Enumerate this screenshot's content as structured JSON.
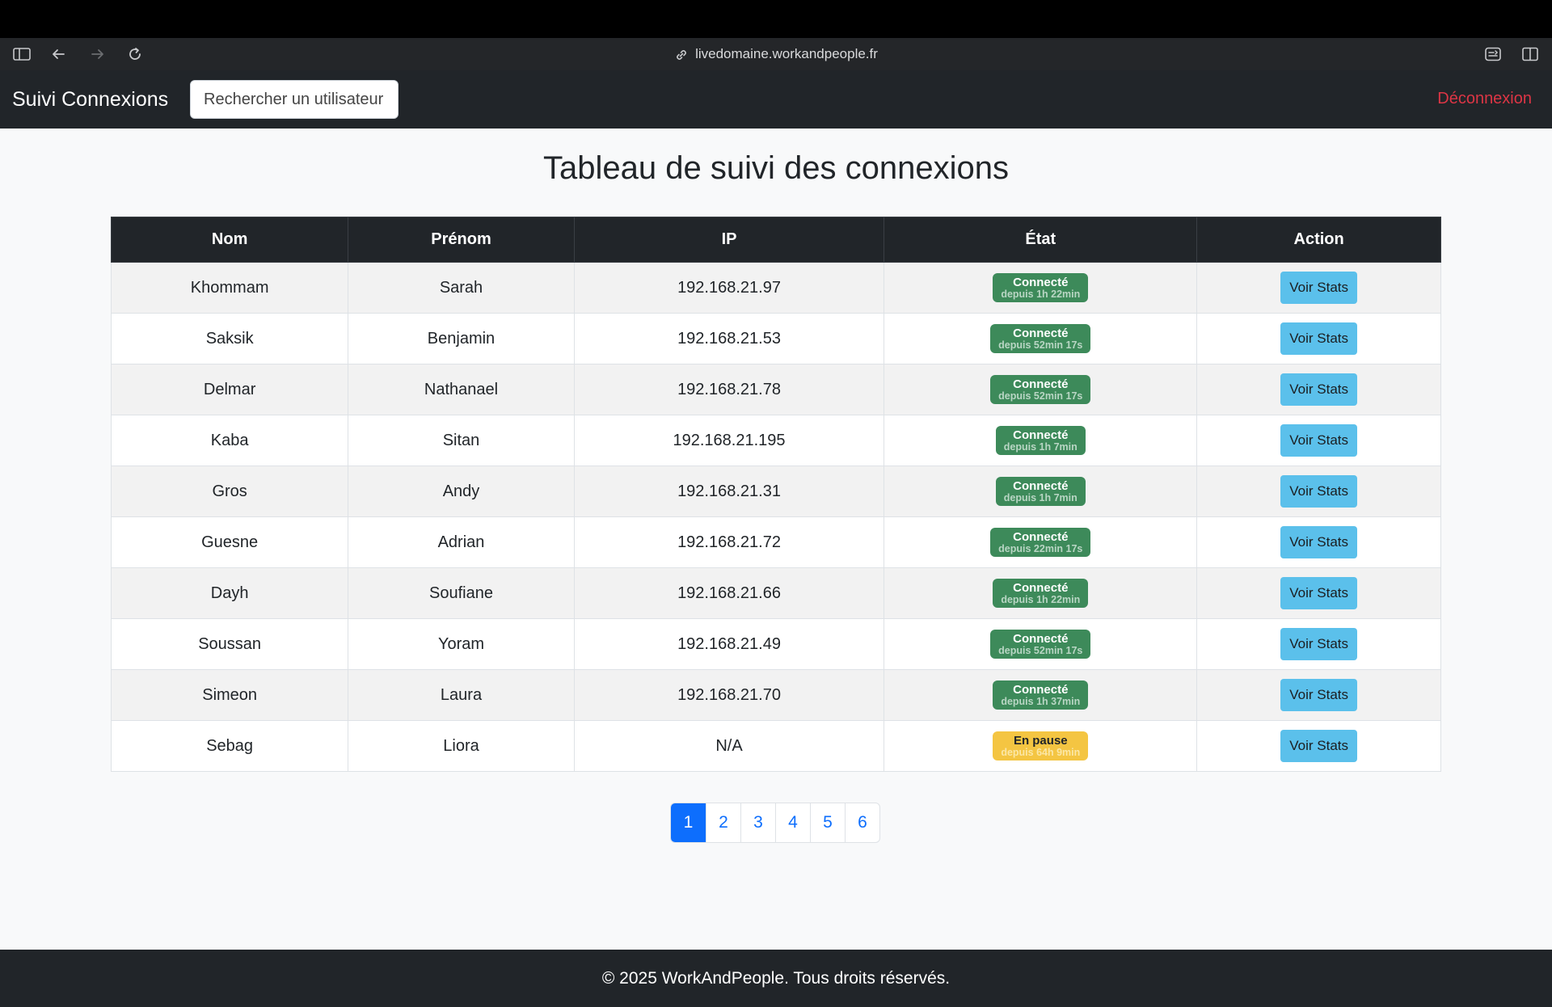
{
  "browser": {
    "url": "livedomaine.workandpeople.fr"
  },
  "navbar": {
    "brand": "Suivi Connexions",
    "search_placeholder": "Rechercher un utilisateur",
    "logout_label": "Déconnexion"
  },
  "page_title": "Tableau de suivi des connexions",
  "table": {
    "headers": [
      "Nom",
      "Prénom",
      "IP",
      "État",
      "Action"
    ],
    "rows": [
      {
        "nom": "Khommam",
        "prenom": "Sarah",
        "ip": "192.168.21.97",
        "etat": "Connecté",
        "depuis": "depuis 1h 22min",
        "status": "ok",
        "action": "Voir Stats"
      },
      {
        "nom": "Saksik",
        "prenom": "Benjamin",
        "ip": "192.168.21.53",
        "etat": "Connecté",
        "depuis": "depuis 52min 17s",
        "status": "ok",
        "action": "Voir Stats"
      },
      {
        "nom": "Delmar",
        "prenom": "Nathanael",
        "ip": "192.168.21.78",
        "etat": "Connecté",
        "depuis": "depuis 52min 17s",
        "status": "ok",
        "action": "Voir Stats"
      },
      {
        "nom": "Kaba",
        "prenom": "Sitan",
        "ip": "192.168.21.195",
        "etat": "Connecté",
        "depuis": "depuis 1h 7min",
        "status": "ok",
        "action": "Voir Stats"
      },
      {
        "nom": "Gros",
        "prenom": "Andy",
        "ip": "192.168.21.31",
        "etat": "Connecté",
        "depuis": "depuis 1h 7min",
        "status": "ok",
        "action": "Voir Stats"
      },
      {
        "nom": "Guesne",
        "prenom": "Adrian",
        "ip": "192.168.21.72",
        "etat": "Connecté",
        "depuis": "depuis 22min 17s",
        "status": "ok",
        "action": "Voir Stats"
      },
      {
        "nom": "Dayh",
        "prenom": "Soufiane",
        "ip": "192.168.21.66",
        "etat": "Connecté",
        "depuis": "depuis 1h 22min",
        "status": "ok",
        "action": "Voir Stats"
      },
      {
        "nom": "Soussan",
        "prenom": "Yoram",
        "ip": "192.168.21.49",
        "etat": "Connecté",
        "depuis": "depuis 52min 17s",
        "status": "ok",
        "action": "Voir Stats"
      },
      {
        "nom": "Simeon",
        "prenom": "Laura",
        "ip": "192.168.21.70",
        "etat": "Connecté",
        "depuis": "depuis 1h 37min",
        "status": "ok",
        "action": "Voir Stats"
      },
      {
        "nom": "Sebag",
        "prenom": "Liora",
        "ip": "N/A",
        "etat": "En pause",
        "depuis": "depuis 64h 9min",
        "status": "pause",
        "action": "Voir Stats"
      }
    ]
  },
  "pagination": {
    "pages": [
      "1",
      "2",
      "3",
      "4",
      "5",
      "6"
    ],
    "active": "1"
  },
  "footer": "© 2025 WorkAndPeople. Tous droits réservés.",
  "colors": {
    "navbar": "#212529",
    "connected_badge": "#3d8a5a",
    "pause_badge": "#f4c542",
    "stats_button": "#5bc0eb",
    "logout": "#dc3545",
    "page_active": "#0d6efd"
  }
}
